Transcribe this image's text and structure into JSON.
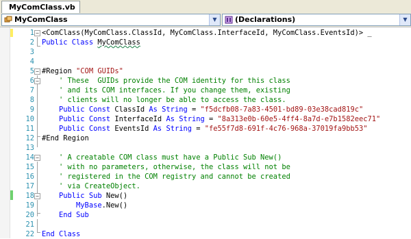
{
  "tab": {
    "label": "MyComClass.vb"
  },
  "nav": {
    "left_value": "MyComClass",
    "right_value": "(Declarations)",
    "left_icon": "class-icon",
    "right_icon": "declarations-icon"
  },
  "editor": {
    "lines": [
      {
        "num": "1",
        "outline": "−",
        "parts": [
          [
            "n",
            "<ComClass(MyComClass.ClassId, MyComClass.InterfaceId, MyComClass.EventsId)> _"
          ]
        ]
      },
      {
        "num": "2",
        "outline": "",
        "parts": [
          [
            "k",
            "Public Class "
          ],
          [
            "sq",
            "MyComClass"
          ]
        ]
      },
      {
        "num": "3",
        "outline": "",
        "parts": []
      },
      {
        "num": "4",
        "outline": "",
        "parts": []
      },
      {
        "num": "5",
        "outline": "−",
        "parts": [
          [
            "n",
            "#Region "
          ],
          [
            "s",
            "\"COM GUIDs\""
          ]
        ]
      },
      {
        "num": "6",
        "outline": "−",
        "parts": [
          [
            "c",
            "    ' These  GUIDs provide the COM identity for this class "
          ]
        ]
      },
      {
        "num": "7",
        "outline": "",
        "parts": [
          [
            "c",
            "    ' and its COM interfaces. If you change them, existing "
          ]
        ]
      },
      {
        "num": "8",
        "outline": "",
        "parts": [
          [
            "c",
            "    ' clients will no longer be able to access the class."
          ]
        ]
      },
      {
        "num": "9",
        "outline": "",
        "parts": [
          [
            "k",
            "    Public Const "
          ],
          [
            "n",
            "ClassId "
          ],
          [
            "k",
            "As String"
          ],
          [
            "n",
            " = "
          ],
          [
            "s",
            "\"f5dcfb08-7a83-4501-bd89-03e38cad819c\""
          ]
        ]
      },
      {
        "num": "10",
        "outline": "",
        "parts": [
          [
            "k",
            "    Public Const "
          ],
          [
            "n",
            "InterfaceId "
          ],
          [
            "k",
            "As String"
          ],
          [
            "n",
            " = "
          ],
          [
            "s",
            "\"8a313e0b-60e5-4ff4-8a7d-e7b1582eec71\""
          ]
        ]
      },
      {
        "num": "11",
        "outline": "",
        "parts": [
          [
            "k",
            "    Public Const "
          ],
          [
            "n",
            "EventsId "
          ],
          [
            "k",
            "As String"
          ],
          [
            "n",
            " = "
          ],
          [
            "s",
            "\"fe55f7d8-691f-4c76-968a-37019fa9bb53\""
          ]
        ]
      },
      {
        "num": "12",
        "outline": "",
        "parts": [
          [
            "n",
            "#End Region"
          ]
        ]
      },
      {
        "num": "13",
        "outline": "",
        "parts": []
      },
      {
        "num": "14",
        "outline": "−",
        "parts": [
          [
            "c",
            "    ' A creatable COM class must have a Public Sub New() "
          ]
        ]
      },
      {
        "num": "15",
        "outline": "",
        "parts": [
          [
            "c",
            "    ' with no parameters, otherwise, the class will not be "
          ]
        ]
      },
      {
        "num": "16",
        "outline": "",
        "parts": [
          [
            "c",
            "    ' registered in the COM registry and cannot be created "
          ]
        ]
      },
      {
        "num": "17",
        "outline": "",
        "parts": [
          [
            "c",
            "    ' via CreateObject."
          ]
        ]
      },
      {
        "num": "18",
        "outline": "−",
        "parts": [
          [
            "k",
            "    Public Sub "
          ],
          [
            "n",
            "New()"
          ]
        ]
      },
      {
        "num": "19",
        "outline": "",
        "parts": [
          [
            "k",
            "        MyBase"
          ],
          [
            "n",
            ".New()"
          ]
        ]
      },
      {
        "num": "20",
        "outline": "",
        "parts": [
          [
            "k",
            "    End Sub"
          ]
        ]
      },
      {
        "num": "21",
        "outline": "",
        "parts": []
      },
      {
        "num": "22",
        "outline": "",
        "parts": [
          [
            "k",
            "End Class"
          ]
        ]
      }
    ]
  }
}
